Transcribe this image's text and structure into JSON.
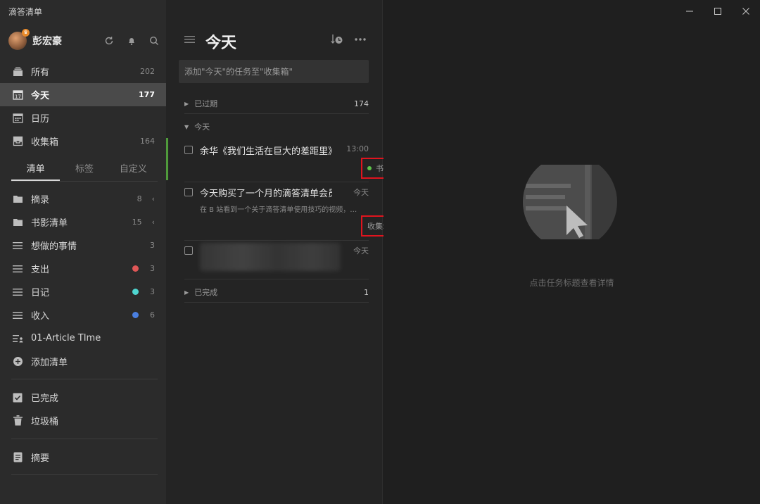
{
  "app": {
    "title": "滴答清单"
  },
  "user": {
    "name": "彭宏豪"
  },
  "sidebar": {
    "smart": [
      {
        "label": "所有",
        "count": "202"
      },
      {
        "label": "今天",
        "count": "177"
      },
      {
        "label": "日历",
        "count": ""
      },
      {
        "label": "收集箱",
        "count": "164"
      }
    ],
    "tabs": [
      "清单",
      "标签",
      "自定义"
    ],
    "lists": [
      {
        "label": "摘录",
        "count": "8",
        "chevron": "‹"
      },
      {
        "label": "书影清单",
        "count": "15",
        "chevron": "‹"
      },
      {
        "label": "想做的事情",
        "count": "3"
      },
      {
        "label": "支出",
        "count": "3",
        "color": "#e05757"
      },
      {
        "label": "日记",
        "count": "3",
        "color": "#4fd6d0"
      },
      {
        "label": "收入",
        "count": "6",
        "color": "#4a7fe0"
      },
      {
        "label": "01-Article TIme",
        "count": ""
      }
    ],
    "add_list": "添加清单",
    "completed": "已完成",
    "trash": "垃圾桶",
    "summary": "摘要"
  },
  "main": {
    "title": "今天",
    "add_placeholder": "添加\"今天\"的任务至\"收集箱\"",
    "sections": {
      "overdue": {
        "label": "已过期",
        "count": "174"
      },
      "today": {
        "label": "今天"
      },
      "done": {
        "label": "已完成",
        "count": "1"
      }
    },
    "tasks": [
      {
        "title": "余华《我们生活在巨大的差距里》",
        "time": "13:00",
        "tag": "书单"
      },
      {
        "title": "今天购买了一个月的滴答清单会员",
        "time": "今天",
        "desc": "在 B 站看到一个关于滴答清单使用技巧的视频，…",
        "tag": "收集箱"
      },
      {
        "title": "",
        "time": "今天"
      }
    ]
  },
  "detail": {
    "empty_text": "点击任务标题查看详情"
  },
  "colors": {
    "accent_green": "#5cc24a",
    "highlight_red": "#e0141e",
    "active_bg": "#4a4a4a"
  }
}
